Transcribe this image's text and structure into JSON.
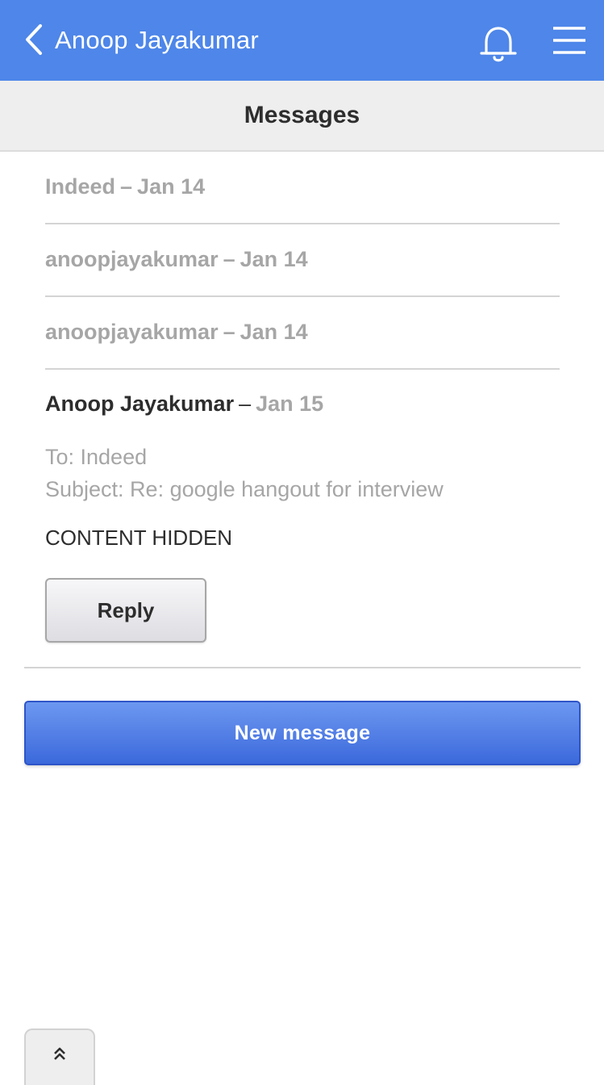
{
  "topbar": {
    "title": "Anoop Jayakumar",
    "background": "#4e86e9",
    "icons": {
      "back": "chevron-left-icon",
      "notifications": "bell-icon",
      "menu": "hamburger-menu-icon"
    }
  },
  "subheader": {
    "title": "Messages"
  },
  "messages": [
    {
      "sender": "Indeed",
      "separator": "–",
      "date": "Jan 14"
    },
    {
      "sender": "anoopjayakumar",
      "separator": "–",
      "date": "Jan 14"
    },
    {
      "sender": "anoopjayakumar",
      "separator": "–",
      "date": "Jan 14"
    }
  ],
  "expanded_message": {
    "sender": "Anoop Jayakumar",
    "separator": "–",
    "date": "Jan 15",
    "to": "To: Indeed",
    "subject": "Subject: Re: google hangout for interview",
    "body": "CONTENT HIDDEN",
    "reply_label": "Reply"
  },
  "new_message_label": "New message",
  "scroll_top_icon": "double-chevron-up-icon",
  "colors": {
    "accent": "#4e86e9",
    "button_blue": "#3b69db",
    "muted_text": "#a6a6a6"
  }
}
